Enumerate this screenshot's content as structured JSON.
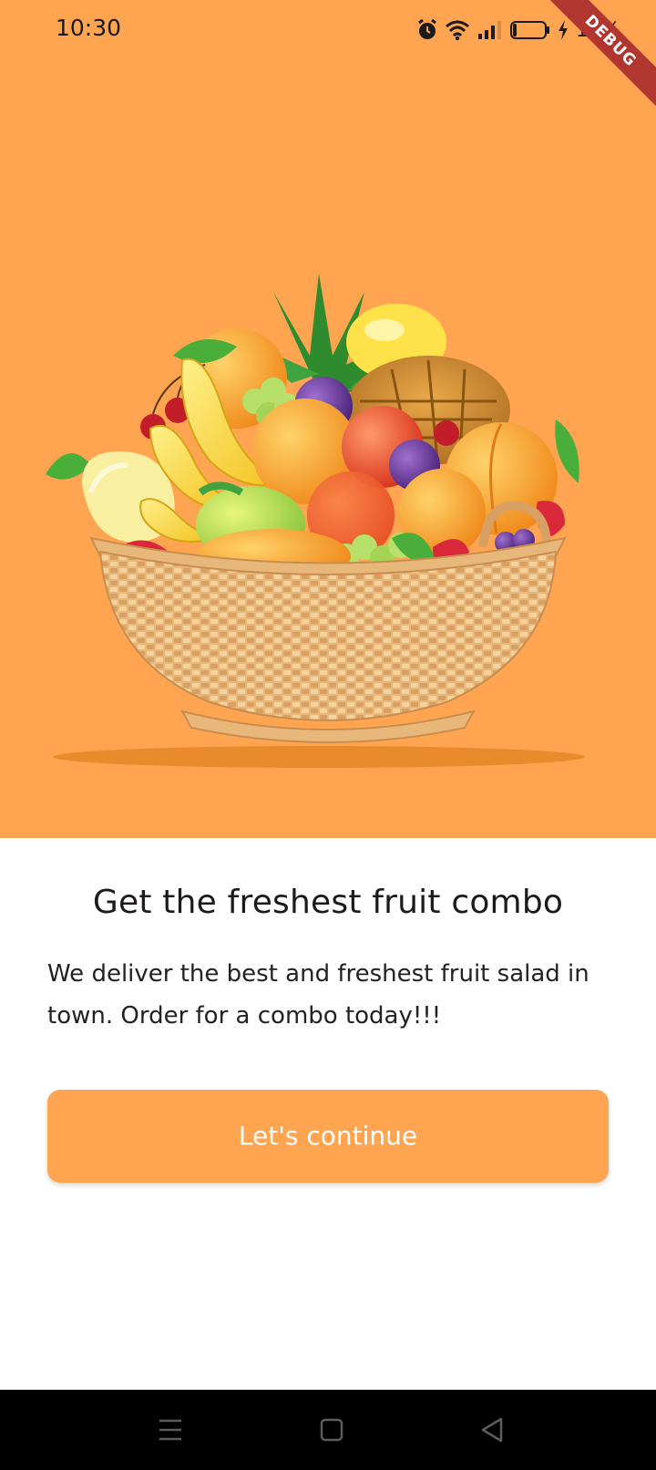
{
  "status_bar": {
    "time": "10:30",
    "battery_percent": "11%",
    "icons": [
      "alarm-icon",
      "wifi-icon",
      "signal-icon",
      "battery-icon",
      "charging-icon"
    ]
  },
  "debug_banner": "DEBUG",
  "hero": {
    "background_color": "#FFA451",
    "image": "fruit-basket-illustration"
  },
  "onboarding": {
    "title": "Get the freshest fruit combo",
    "description": "We deliver the best and freshest fruit salad in town. Order for a combo today!!!",
    "continue_label": "Let's continue"
  },
  "nav_bar": {
    "buttons": [
      "menu-icon",
      "home-icon",
      "back-icon"
    ]
  },
  "colors": {
    "accent": "#FFA451",
    "text_dark": "#27214D"
  }
}
